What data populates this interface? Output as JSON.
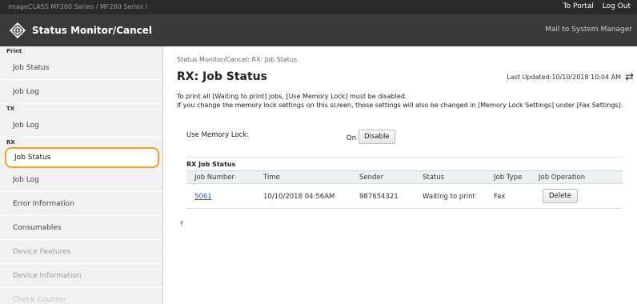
{
  "topbar": {
    "breadcrumb": "imageCLASS      MF260 Series / MF260 Series /",
    "portal_link": "To Portal",
    "logout_link": "Log Out"
  },
  "header": {
    "title": "Status Monitor/Cancel",
    "mail_link": "Mail to System Manager",
    "logo_icon": "status-monitor-icon"
  },
  "sidebar": {
    "sections": [
      {
        "heading": "Print",
        "items": [
          {
            "label": "Job Status"
          },
          {
            "label": "Job Log"
          }
        ]
      },
      {
        "heading": "TX",
        "items": [
          {
            "label": "Job Log"
          }
        ]
      },
      {
        "heading": "RX",
        "items": [
          {
            "label": "Job Status"
          },
          {
            "label": "Job Log"
          }
        ]
      }
    ],
    "extra_items": [
      {
        "label": "Error Information"
      },
      {
        "label": "Consumables"
      },
      {
        "label": "Device Features"
      },
      {
        "label": "Device Information"
      },
      {
        "label": "Check Counter"
      }
    ],
    "active_color": "#f2a126"
  },
  "main": {
    "breadcrumb": "Status Monitor/Cancel: RX: Job Status",
    "title": "RX: Job Status",
    "last_updated": "Last Updated:10/10/2018 10:04 AM",
    "refresh_icon": "refresh-icon",
    "note1": "To print all [Waiting to print] jobs, [Use Memory Lock] must be disabled.",
    "note2": "If you change the memory lock settings on this screen, those settings will also be changed in [Memory Lock Settings] under [Fax Settings].",
    "memory_lock": {
      "label": "Use Memory Lock:",
      "state": "On",
      "button": "Disable"
    },
    "table": {
      "title": "RX Job Status",
      "headers": [
        "Job Number",
        "Time",
        "Sender",
        "Status",
        "Job Type",
        "Job Operation"
      ],
      "rows": [
        {
          "job_number": "5061",
          "time": "10/10/2018 04:56AM",
          "sender": "987654321",
          "status": "Waiting to print",
          "job_type": "Fax",
          "operation": "Delete"
        }
      ]
    },
    "back_to_top_icon": "back-to-top-icon"
  }
}
